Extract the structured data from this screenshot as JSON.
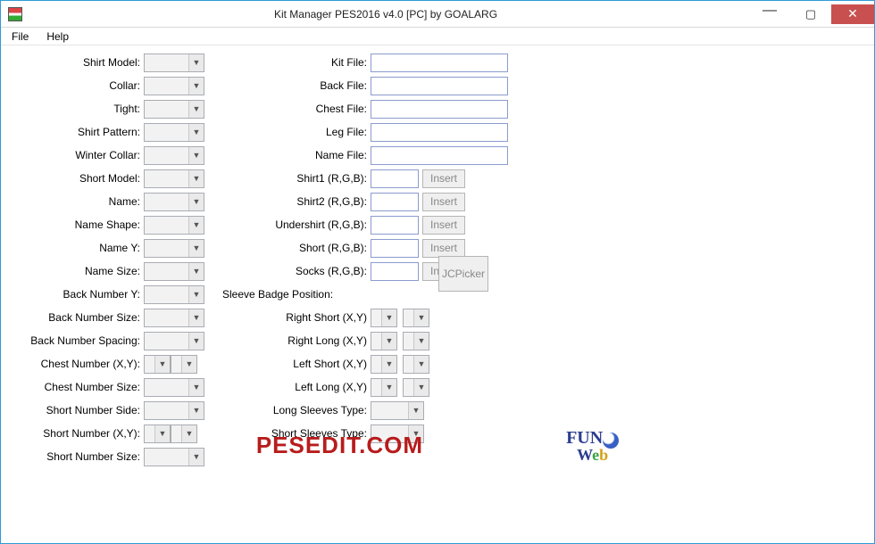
{
  "window": {
    "title": "Kit Manager PES2016 v4.0 [PC] by GOALARG"
  },
  "menu": {
    "file": "File",
    "help": "Help"
  },
  "left": {
    "shirtModel": "Shirt Model:",
    "collar": "Collar:",
    "tight": "Tight:",
    "shirtPattern": "Shirt Pattern:",
    "winterCollar": "Winter Collar:",
    "shortModel": "Short Model:",
    "name": "Name:",
    "nameShape": "Name Shape:",
    "nameY": "Name Y:",
    "nameSize": "Name Size:",
    "backNumberY": "Back Number Y:",
    "backNumberSize": "Back Number Size:",
    "backNumberSpacing": "Back Number Spacing:",
    "chestNumberXY": "Chest Number (X,Y):",
    "chestNumberSize": "Chest Number Size:",
    "shortNumberSide": "Short Number Side:",
    "shortNumberXY": "Short Number (X,Y):",
    "shortNumberSize": "Short Number Size:"
  },
  "right": {
    "kitFile": "Kit File:",
    "backFile": "Back File:",
    "chestFile": "Chest File:",
    "legFile": "Leg File:",
    "nameFile": "Name File:",
    "shirt1": "Shirt1 (R,G,B):",
    "shirt2": "Shirt2 (R,G,B):",
    "undershirt": "Undershirt (R,G,B):",
    "short": "Short (R,G,B):",
    "socks": "Socks (R,G,B):",
    "sleeveBadge": "Sleeve Badge Position:",
    "rightShort": "Right Short (X,Y)",
    "rightLong": "Right Long (X,Y)",
    "leftShort": "Left Short (X,Y)",
    "leftLong": "Left Long (X,Y)",
    "longSleeves": "Long Sleeves Type:",
    "shortSleeves": "Short Sleeves Type:"
  },
  "btns": {
    "insert": "Insert",
    "jcpicker": "JCPicker"
  },
  "footer": {
    "pesedit": "PESEDIT.COM",
    "fun": "FUN",
    "web_w": "W",
    "web_e": "e",
    "web_b": "b"
  }
}
